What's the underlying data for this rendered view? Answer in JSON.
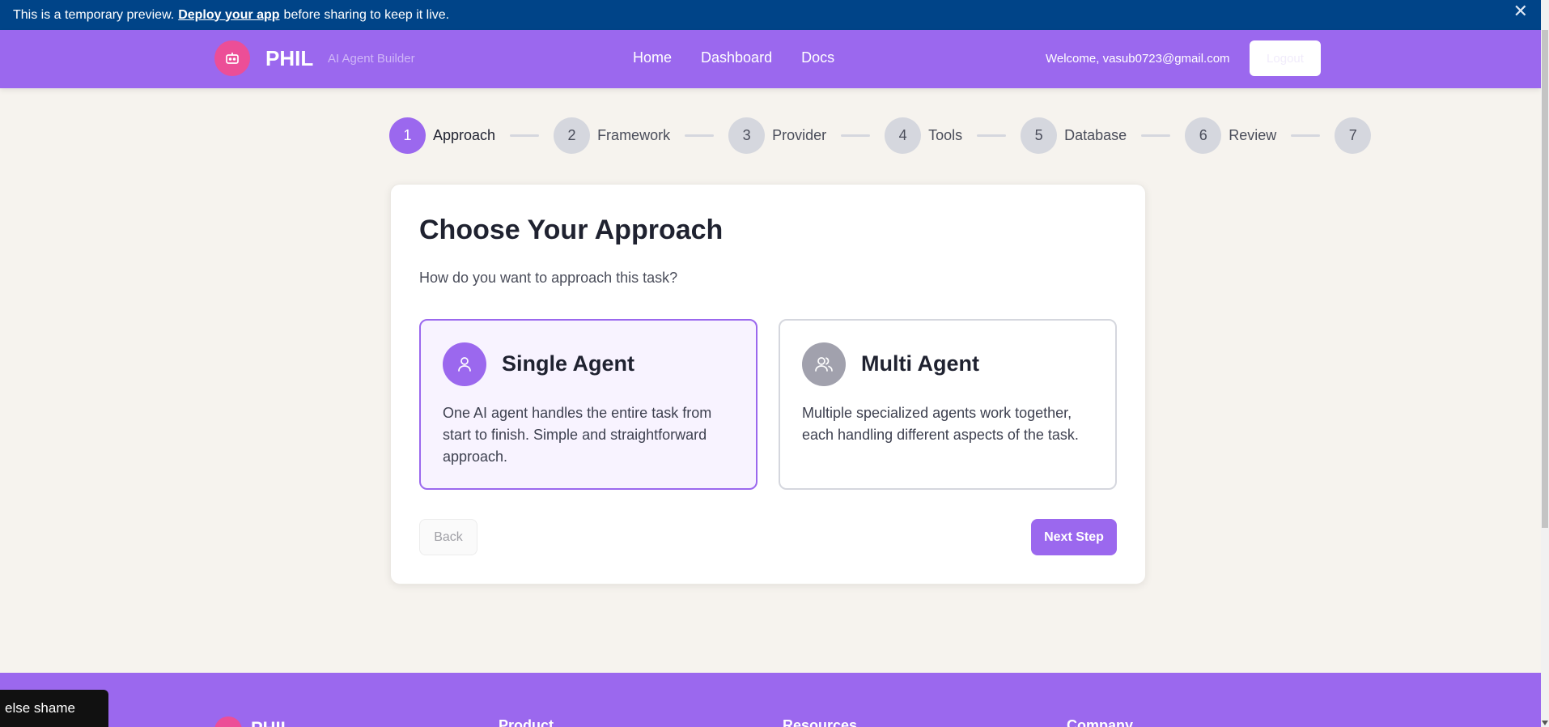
{
  "banner": {
    "text_before": "This is a temporary preview.",
    "link": "Deploy your app",
    "text_after": "before sharing to keep it live.",
    "close": "✕"
  },
  "header": {
    "brand": "PHIL",
    "tagline": "AI Agent Builder",
    "nav": [
      "Home",
      "Dashboard",
      "Docs"
    ],
    "welcome": "Welcome, vasub0723@gmail.com",
    "logout": "Logout"
  },
  "stepper": {
    "steps": [
      {
        "num": "1",
        "label": "Approach",
        "active": true
      },
      {
        "num": "2",
        "label": "Framework"
      },
      {
        "num": "3",
        "label": "Provider"
      },
      {
        "num": "4",
        "label": "Tools"
      },
      {
        "num": "5",
        "label": "Database"
      },
      {
        "num": "6",
        "label": "Review"
      },
      {
        "num": "7",
        "label": ""
      }
    ]
  },
  "card": {
    "title": "Choose Your Approach",
    "subtitle": "How do you want to approach this task?",
    "options": [
      {
        "title": "Single Agent",
        "desc": "One AI agent handles the entire task from start to finish. Simple and straightforward approach.",
        "selected": true,
        "icon": "user-icon"
      },
      {
        "title": "Multi Agent",
        "desc": "Multiple specialized agents work together, each handling different aspects of the task.",
        "selected": false,
        "icon": "users-icon"
      }
    ],
    "back": "Back",
    "next": "Next Step"
  },
  "footer": {
    "brand": "PHIL",
    "columns": [
      "Product",
      "Resources",
      "Company"
    ]
  },
  "toast": {
    "text": "else shame"
  },
  "colors": {
    "accent": "#9b68ee",
    "banner": "#004488",
    "logo": "#ec4e97",
    "background": "#f6f3ee"
  }
}
